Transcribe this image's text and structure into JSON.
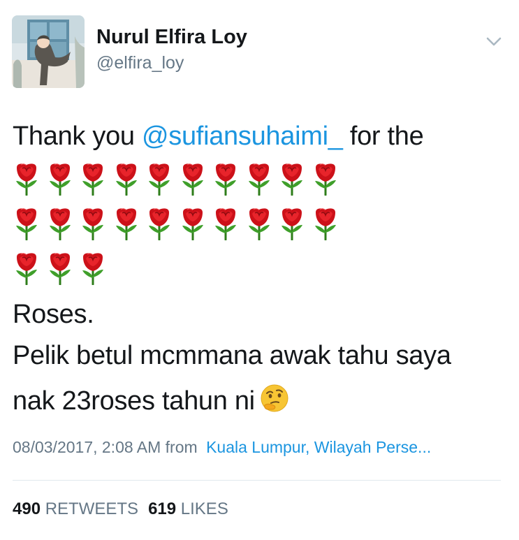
{
  "author": {
    "name": "Nurul Elfira Loy",
    "handle": "@elfira_loy"
  },
  "tweet": {
    "line1_prefix": "Thank you ",
    "line1_mention": "@sufiansuhaimi_",
    "line1_suffix": " for the",
    "rose_rows": [
      10,
      10,
      3
    ],
    "rose_icon": "rose-icon",
    "line_roses": "Roses.",
    "line_question": "Pelik betul mcmmana awak tahu saya",
    "line_last": "nak 23roses tahun ni",
    "emoji_icon": "thinking-face-icon"
  },
  "meta": {
    "timestamp": "08/03/2017, 2:08 AM",
    "from_label": "from",
    "location": "Kuala Lumpur, Wilayah Perse..."
  },
  "stats": {
    "retweets_count": "490",
    "retweets_label": "RETWEETS",
    "likes_count": "619",
    "likes_label": "LIKES"
  },
  "colors": {
    "link": "#1b95e0",
    "secondary_text": "#657786",
    "rose": "#d0021b"
  }
}
